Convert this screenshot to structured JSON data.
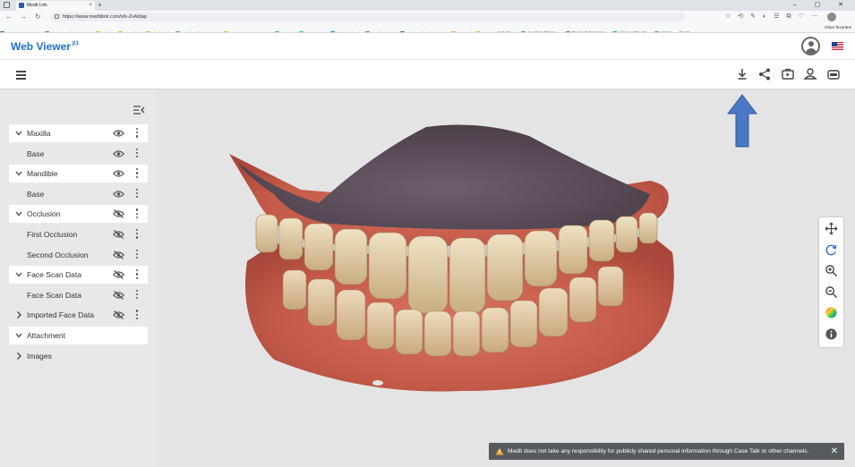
{
  "browser": {
    "tab_title": "Medit Link",
    "tab_close": "×",
    "new_tab": "+",
    "url": "https://www.meditlink.com/s/k-ZvAIdap",
    "window_controls": "– ▢ ✕",
    "bookmarks": [
      {
        "label": "MEDIT Groupware",
        "color": "#2c5fa8"
      },
      {
        "label": "Sign in - ClearCorre...",
        "color": "#d94c3d"
      },
      {
        "label": "Admin",
        "color": "#e0b040"
      },
      {
        "label": "Bizadmin",
        "color": "#e0b040"
      },
      {
        "label": "Medit Link",
        "color": "#e0b040"
      },
      {
        "label": "QuickBuild - the bu...",
        "color": "#4b8bd6"
      },
      {
        "label": "TeamViewer Manag...",
        "color": "#e0b040"
      },
      {
        "label": "Papago",
        "color": "#2cb34a"
      },
      {
        "label": "Grammarly",
        "color": "#15c39a"
      },
      {
        "label": "(3) Facebook",
        "color": "#1877f2"
      },
      {
        "label": "Medit - Agent",
        "color": "#d94c3d"
      },
      {
        "label": "YOPmail - Disposab...",
        "color": "#3b5fb0"
      },
      {
        "label": "Summi",
        "color": "#e0b040"
      },
      {
        "label": "Chrome 원격 데스...",
        "color": "#e0b040"
      },
      {
        "label": "우성치 통합본어 -...",
        "color": "#4b8bd6"
      },
      {
        "label": "한국어 맞춤법/문법...",
        "color": "#6a6a6a"
      },
      {
        "label": "네이버 어학사전...",
        "color": "#2cb34a"
      },
      {
        "label": "원도우 10 해방된...",
        "color": "#4b8bd6"
      }
    ],
    "other_favorites": "Other favorites"
  },
  "header": {
    "brand": "Web Viewer",
    "brand_sup": "β1"
  },
  "tree": [
    {
      "label": "Maxilla",
      "type": "header",
      "chevron": "down",
      "visible": true
    },
    {
      "label": "Base",
      "type": "child",
      "visible": true
    },
    {
      "label": "Mandible",
      "type": "header",
      "chevron": "down",
      "visible": true
    },
    {
      "label": "Base",
      "type": "child",
      "visible": true
    },
    {
      "label": "Occlusion",
      "type": "header",
      "chevron": "down",
      "visible": false
    },
    {
      "label": "First Occlusion",
      "type": "child",
      "visible": false
    },
    {
      "label": "Second Occlusion",
      "type": "child",
      "visible": false
    },
    {
      "label": "Face Scan Data",
      "type": "header",
      "chevron": "down",
      "visible": false
    },
    {
      "label": "Face Scan Data",
      "type": "child",
      "visible": false
    },
    {
      "label": "Imported Face Data",
      "type": "child",
      "chevron": "right",
      "visible": false
    },
    {
      "label": "Attachment",
      "type": "header",
      "chevron": "down",
      "noicons": true
    },
    {
      "label": "Images",
      "type": "child",
      "chevron": "right",
      "noicons": true
    }
  ],
  "notice": {
    "text": "Medit does not take any responsibility for publicly shared personal information through Case Talk or other channels.",
    "close": "✕"
  },
  "colors": {
    "brand": "#1f6fd1",
    "arrow": "#4a78c4",
    "gum": "#c8614f",
    "palate": "#5d4f5c",
    "tooth": "#d9c39a"
  },
  "icons": {
    "toolbar": [
      "download-icon",
      "share-icon",
      "screen-record-icon",
      "user-share-icon",
      "toggle-panel-icon"
    ],
    "side_tools": [
      "move-icon",
      "rotate-icon",
      "zoom-in-icon",
      "zoom-out-icon",
      "color-map-icon",
      "info-icon"
    ]
  }
}
